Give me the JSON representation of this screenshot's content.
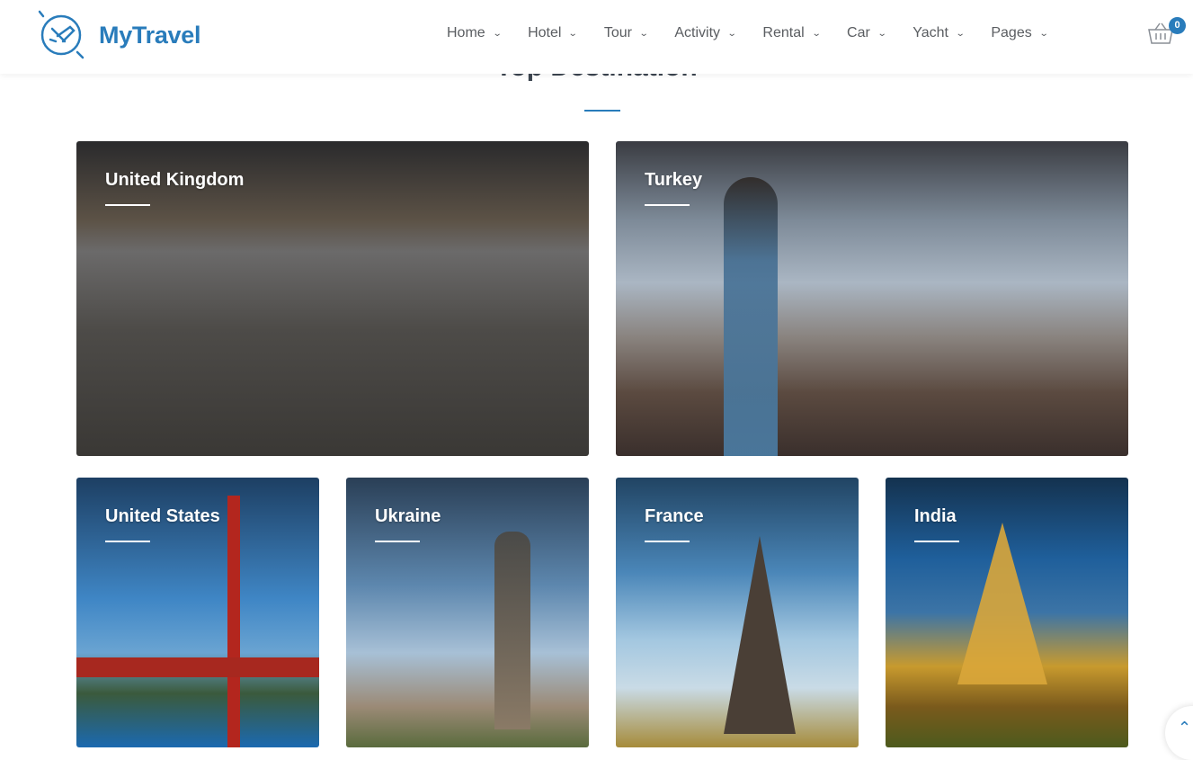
{
  "header": {
    "brand": "MyTravel",
    "cart_count": "0",
    "nav": [
      {
        "label": "Home"
      },
      {
        "label": "Hotel"
      },
      {
        "label": "Tour"
      },
      {
        "label": "Activity"
      },
      {
        "label": "Rental"
      },
      {
        "label": "Car"
      },
      {
        "label": "Yacht"
      },
      {
        "label": "Pages"
      }
    ]
  },
  "section": {
    "title": "Top Destination"
  },
  "destinations": [
    {
      "name": "United Kingdom"
    },
    {
      "name": "Turkey"
    },
    {
      "name": "United States"
    },
    {
      "name": "Ukraine"
    },
    {
      "name": "France"
    },
    {
      "name": "India"
    }
  ],
  "colors": {
    "accent": "#297cbb"
  }
}
